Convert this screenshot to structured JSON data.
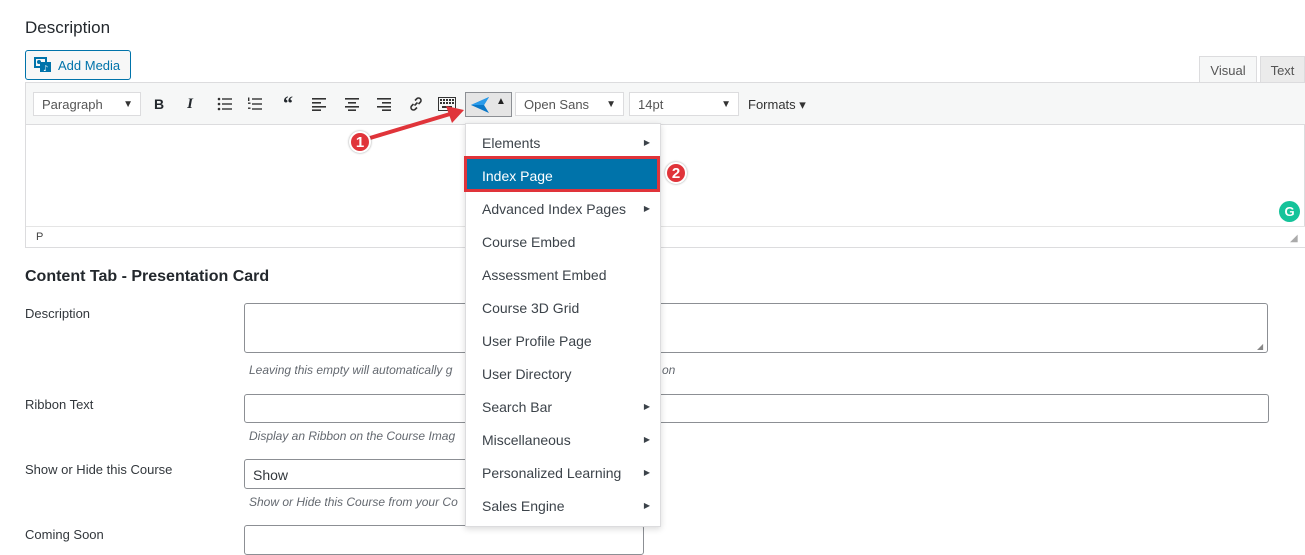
{
  "description_section": {
    "title": "Description",
    "add_media_label": "Add Media",
    "tabs": {
      "visual": "Visual",
      "text": "Text"
    }
  },
  "toolbar": {
    "paragraph_select": "Paragraph",
    "font_select": "Open Sans",
    "size_select": "14pt",
    "formats_label": "Formats ▾",
    "buttons": [
      "bold-icon",
      "italic-icon",
      "bullet-list-icon",
      "numbered-list-icon",
      "blockquote-icon",
      "align-left-icon",
      "align-center-icon",
      "align-right-icon",
      "link-icon",
      "keyboard-icon",
      "plugin-arrow-icon"
    ]
  },
  "editor": {
    "status_path": "P"
  },
  "content_tab": {
    "title": "Content Tab - Presentation Card",
    "fields": [
      {
        "label": "Description",
        "hint": "Leaving this empty will automatically g",
        "hint_tail": "on"
      },
      {
        "label": "Ribbon Text",
        "hint": "Display an Ribbon on the Course Imag"
      },
      {
        "label": "Show or Hide this Course",
        "value": "Show",
        "hint": "Show or Hide this Course from your Co"
      },
      {
        "label": "Coming Soon"
      }
    ]
  },
  "dropdown_menu": {
    "items": [
      {
        "label": "Elements",
        "has_submenu": true
      },
      {
        "label": "Index Page",
        "has_submenu": false,
        "active": true
      },
      {
        "label": "Advanced Index Pages",
        "has_submenu": true
      },
      {
        "label": "Course Embed",
        "has_submenu": false
      },
      {
        "label": "Assessment Embed",
        "has_submenu": false
      },
      {
        "label": "Course 3D Grid",
        "has_submenu": false
      },
      {
        "label": "User Profile Page",
        "has_submenu": false
      },
      {
        "label": "User Directory",
        "has_submenu": false
      },
      {
        "label": "Search Bar",
        "has_submenu": true
      },
      {
        "label": "Miscellaneous",
        "has_submenu": true
      },
      {
        "label": "Personalized Learning",
        "has_submenu": true
      },
      {
        "label": "Sales Engine",
        "has_submenu": true
      }
    ]
  },
  "annotations": {
    "step1": "1",
    "step2": "2"
  },
  "colors": {
    "accent": "#0073aa",
    "annotation_red": "#e0343a",
    "grammarly": "#15c39a"
  }
}
